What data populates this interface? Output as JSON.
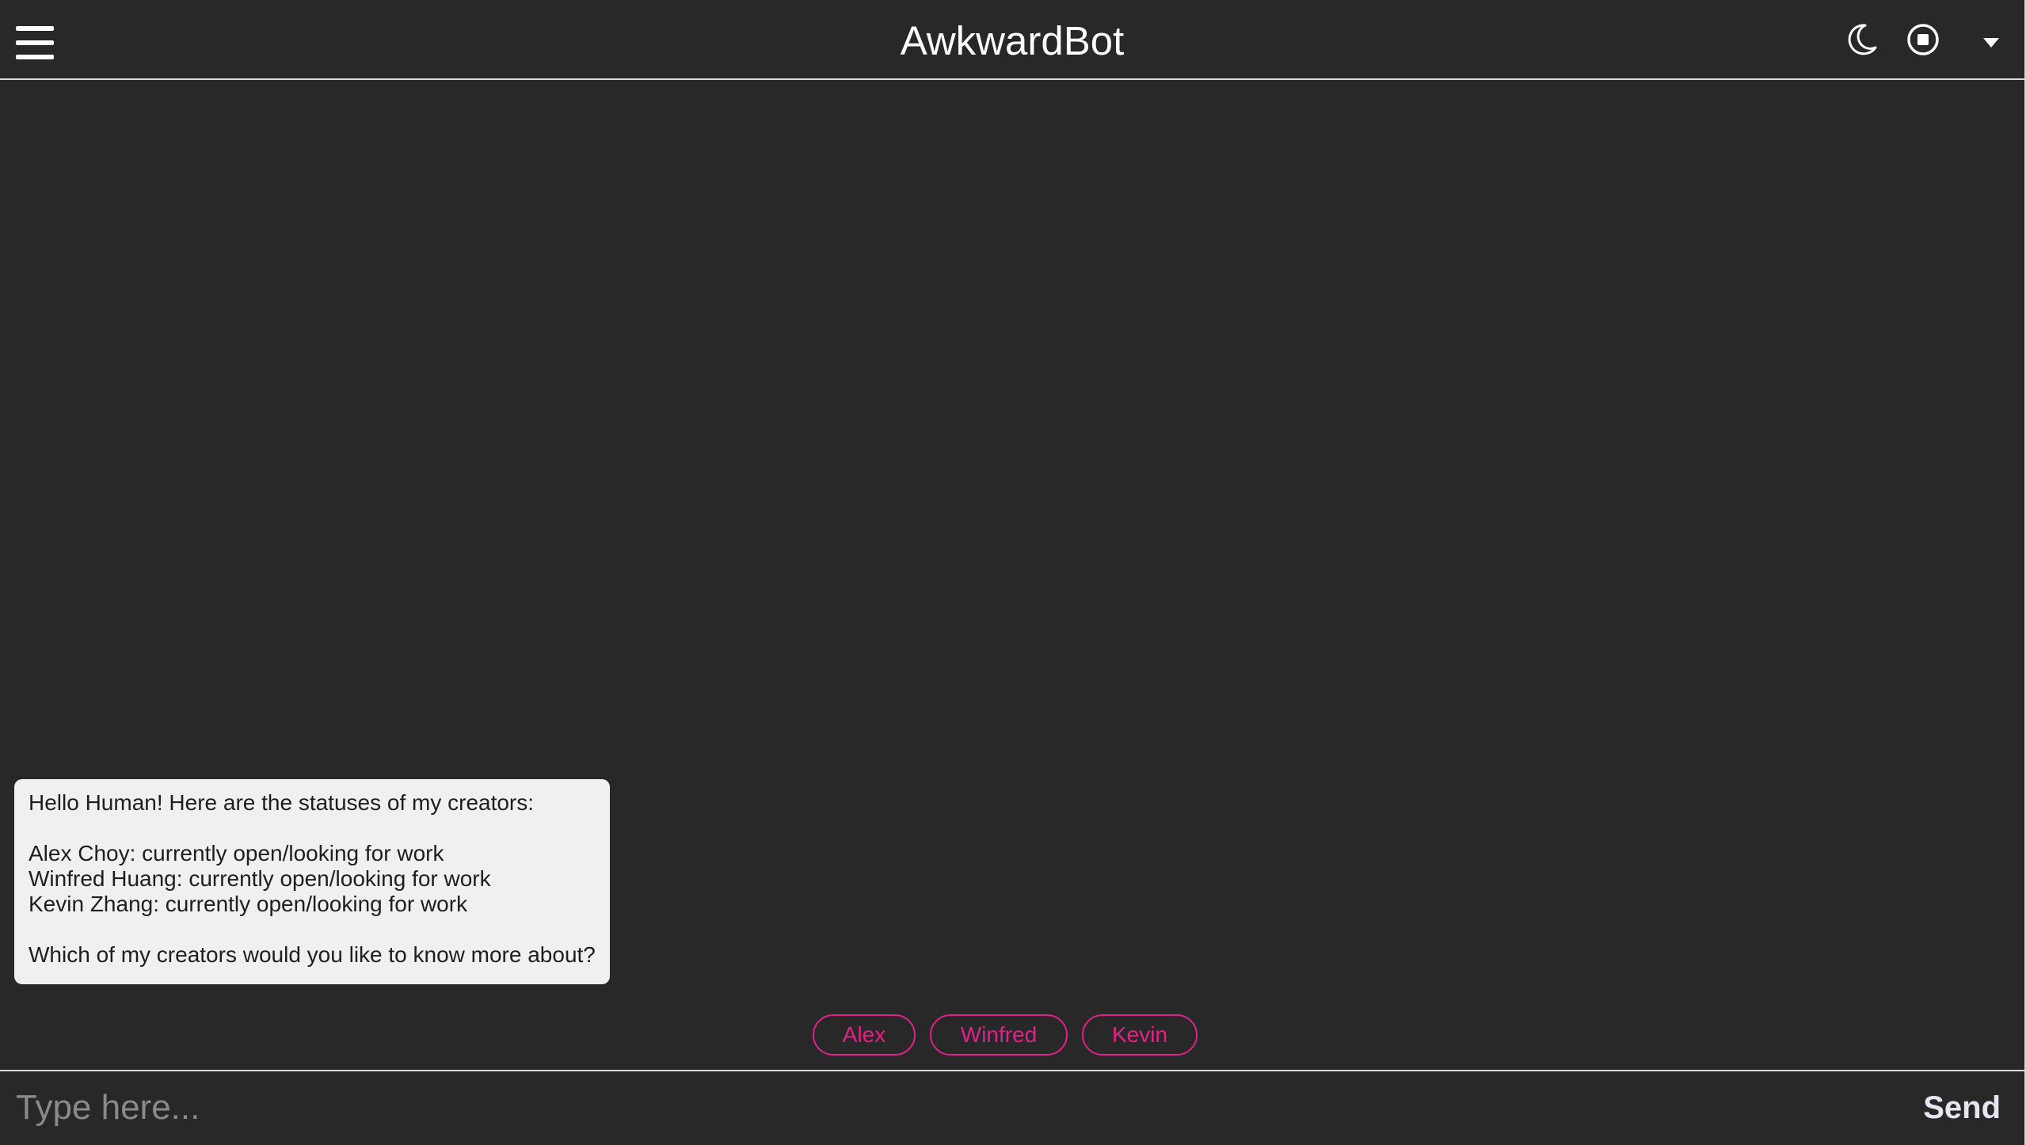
{
  "header": {
    "title": "AwkwardBot",
    "icons": [
      "hamburger-menu-icon",
      "moon-icon",
      "stop-circle-icon",
      "caret-down-icon"
    ]
  },
  "chat": {
    "bot_message": {
      "line1": "Hello Human! Here are the statuses of my creators:",
      "line2": "Alex Choy: currently open/looking for work",
      "line3": "Winfred Huang: currently open/looking for work",
      "line4": "Kevin Zhang: currently open/looking for work",
      "line5": "Which of my creators would you like to know more about?"
    },
    "quick_replies": [
      "Alex",
      "Winfred",
      "Kevin"
    ]
  },
  "composer": {
    "placeholder": "Type here...",
    "send_label": "Send"
  },
  "colors": {
    "background": "#282828",
    "accent": "#e0218a",
    "bubble": "#f0f0f0"
  }
}
